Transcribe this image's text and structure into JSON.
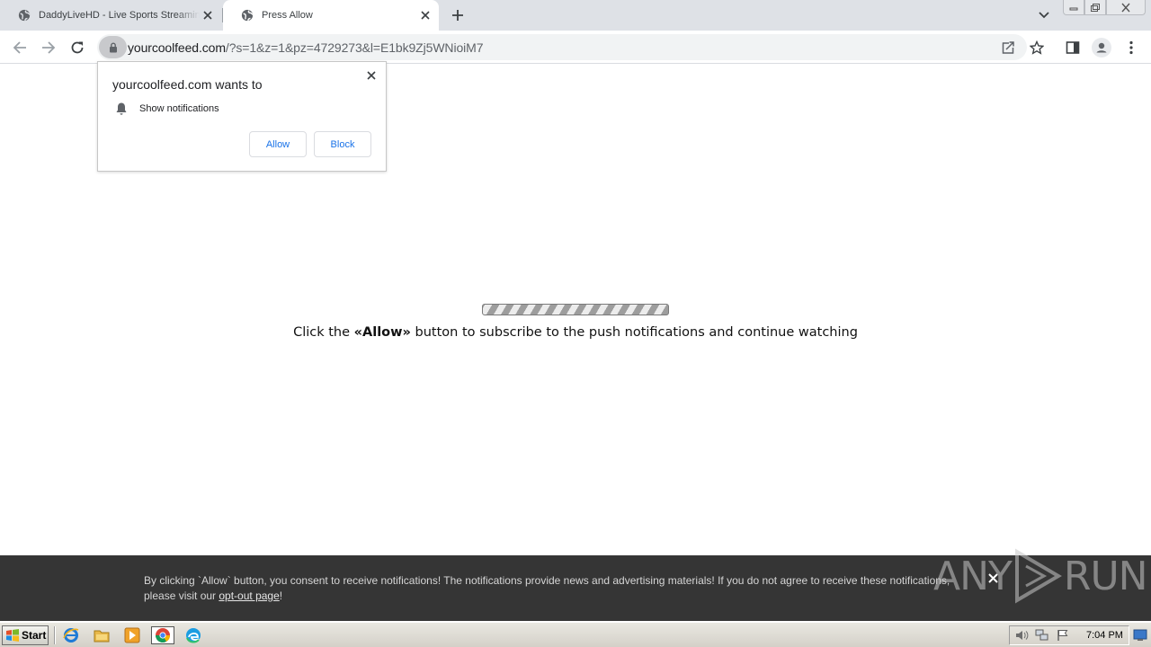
{
  "browser": {
    "tabs": [
      {
        "title": "DaddyLiveHD - Live Sports Streaming",
        "icon": "globe-icon",
        "active": false
      },
      {
        "title": "Press Allow",
        "icon": "globe-icon",
        "active": true
      }
    ],
    "address_host": "yourcoolfeed.com",
    "address_query": "/?s=1&z=1&pz=4729273&l=E1bk9Zj5WNioiM7"
  },
  "permission_prompt": {
    "title": "yourcoolfeed.com wants to",
    "permission_label": "Show notifications",
    "allow_label": "Allow",
    "block_label": "Block"
  },
  "page": {
    "message_pre": "Click the ",
    "message_bold": "«Allow»",
    "message_post": " button to subscribe to the push notifications and continue watching"
  },
  "consent_bar": {
    "text": "By clicking `Allow` button, you consent to receive notifications! The notifications provide news and advertising materials! If you do not agree to receive these notifications, please visit our ",
    "link": "opt-out page",
    "text_end": "!"
  },
  "watermark": {
    "left": "ANY",
    "right": "RUN"
  },
  "taskbar": {
    "start_label": "Start",
    "clock": "7:04 PM"
  },
  "colors": {
    "tabstrip": "#dee1e6",
    "accent_blue": "#1a73e8",
    "consent_bg": "#353535"
  }
}
